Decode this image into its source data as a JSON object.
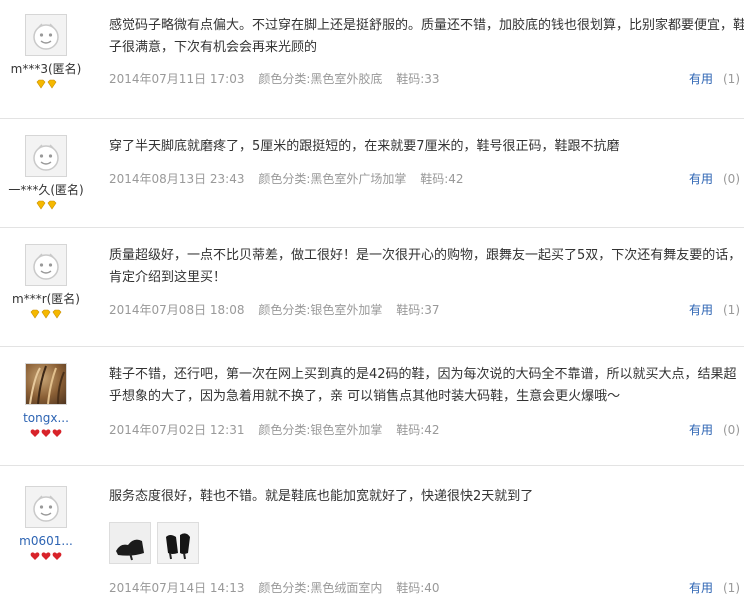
{
  "reviews": [
    {
      "username": "m***3(匿名)",
      "badge_type": "gold",
      "badge_count": 2,
      "text": "感觉码子略微有点偏大。不过穿在脚上还是挺舒服的。质量还不错，加胶底的钱也很划算，比别家都要便宜，鞋子很满意，下次有机会会再来光顾的",
      "date": "2014年07月11日 17:03",
      "color": "颜色分类:黑色室外胶底",
      "size": "鞋码:33",
      "useful_label": "有用",
      "useful_count": "(1)"
    },
    {
      "username": "一***久(匿名)",
      "badge_type": "gold",
      "badge_count": 2,
      "text": "穿了半天脚底就磨疼了，5厘米的跟挺短的，在来就要7厘米的，鞋号很正码，鞋跟不抗磨",
      "date": "2014年08月13日 23:43",
      "color": "颜色分类:黑色室外广场加掌",
      "size": "鞋码:42",
      "useful_label": "有用",
      "useful_count": "(0)"
    },
    {
      "username": "m***r(匿名)",
      "badge_type": "gold",
      "badge_count": 3,
      "text": "质量超级好，一点不比贝蒂差，做工很好！是一次很开心的购物，跟舞友一起买了5双，下次还有舞友要的话，肯定介绍到这里买！",
      "date": "2014年07月08日 18:08",
      "color": "颜色分类:银色室外加掌",
      "size": "鞋码:37",
      "useful_label": "有用",
      "useful_count": "(1)"
    },
    {
      "username": "tongx...",
      "badge_type": "red",
      "badge_count": 3,
      "text": "鞋子不错，还行吧，第一次在网上买到真的是42码的鞋，因为每次说的大码全不靠谱，所以就买大点，结果超乎想象的大了，因为急着用就不换了，亲 可以销售点其他时装大码鞋，生意会更火爆哦～",
      "date": "2014年07月02日 12:31",
      "color": "颜色分类:银色室外加掌",
      "size": "鞋码:42",
      "useful_label": "有用",
      "useful_count": "(0)"
    },
    {
      "username": "m0601...",
      "badge_type": "red",
      "badge_count": 3,
      "text": "服务态度很好，鞋也不错。就是鞋底也能加宽就好了，快递很快2天就到了",
      "date": "2014年07月14日 14:13",
      "color": "颜色分类:黑色绒面室内",
      "size": "鞋码:40",
      "useful_label": "有用",
      "useful_count": "(1)"
    }
  ],
  "colors": {
    "link": "#2d64b3",
    "meta": "#999999",
    "text": "#333333",
    "badge_gold": "#f5b800",
    "badge_red": "#d8232a"
  },
  "icons": {
    "default_avatar": "smiley-avatar-icon",
    "badge_gold": "gold-diamond-icon",
    "badge_red": "red-heart-icon"
  }
}
